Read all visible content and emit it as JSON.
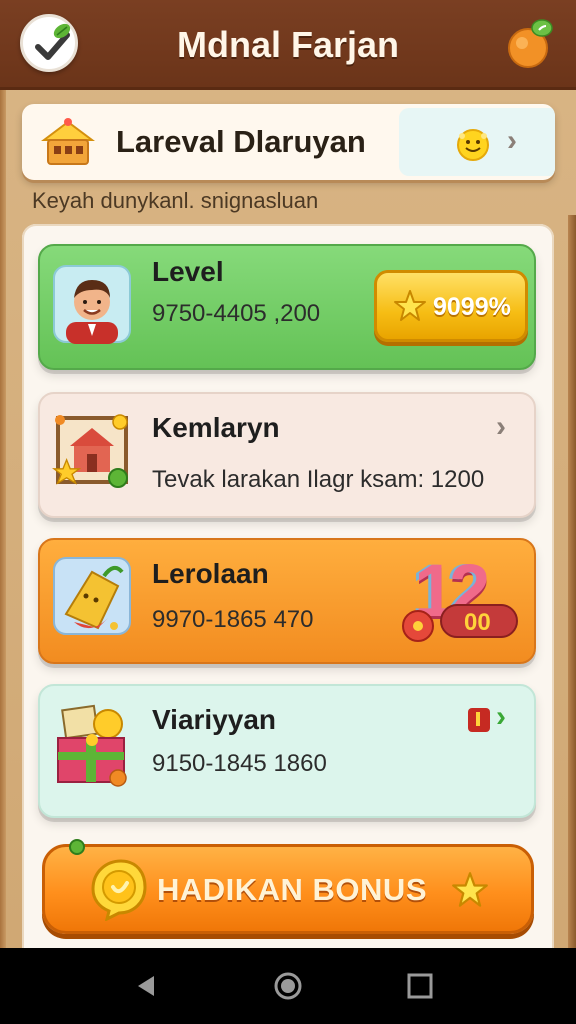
{
  "header": {
    "title": "Mdnal Farjan"
  },
  "banner": {
    "title": "Lareval Dlaruyan"
  },
  "subtitle": "Keyah dunykanl. snignasluan",
  "cards": [
    {
      "title": "Level",
      "subtitle": "9750-4405 ,200",
      "action_label": "9099%",
      "color": "#6ccb5f"
    },
    {
      "title": "Kemlaryn",
      "subtitle": "Tevak larakan Ilagr ksam: 1200",
      "color": "#f8e9e1"
    },
    {
      "title": "Lerolaan",
      "subtitle": "9970-1865  470",
      "badge_big": "12",
      "badge_small": "00",
      "color": "#f59a2a"
    },
    {
      "title": "Viariyyan",
      "subtitle": "9150-1845  1860",
      "color": "#dcf5ec"
    }
  ],
  "bonus_button": {
    "label": "HADIKAN BONUS"
  },
  "icons": {
    "header_left": "check-leaf-icon",
    "header_right": "orange-fruit-icon",
    "banner_left": "cake-house-icon",
    "banner_right": "smiley-star-icon",
    "card1": "avatar-man",
    "card2": "house-frame-icon",
    "card3": "bag-icon",
    "card4": "gift-box-icon",
    "bonus": "coin-icon",
    "bonus_star": "star-icon"
  }
}
